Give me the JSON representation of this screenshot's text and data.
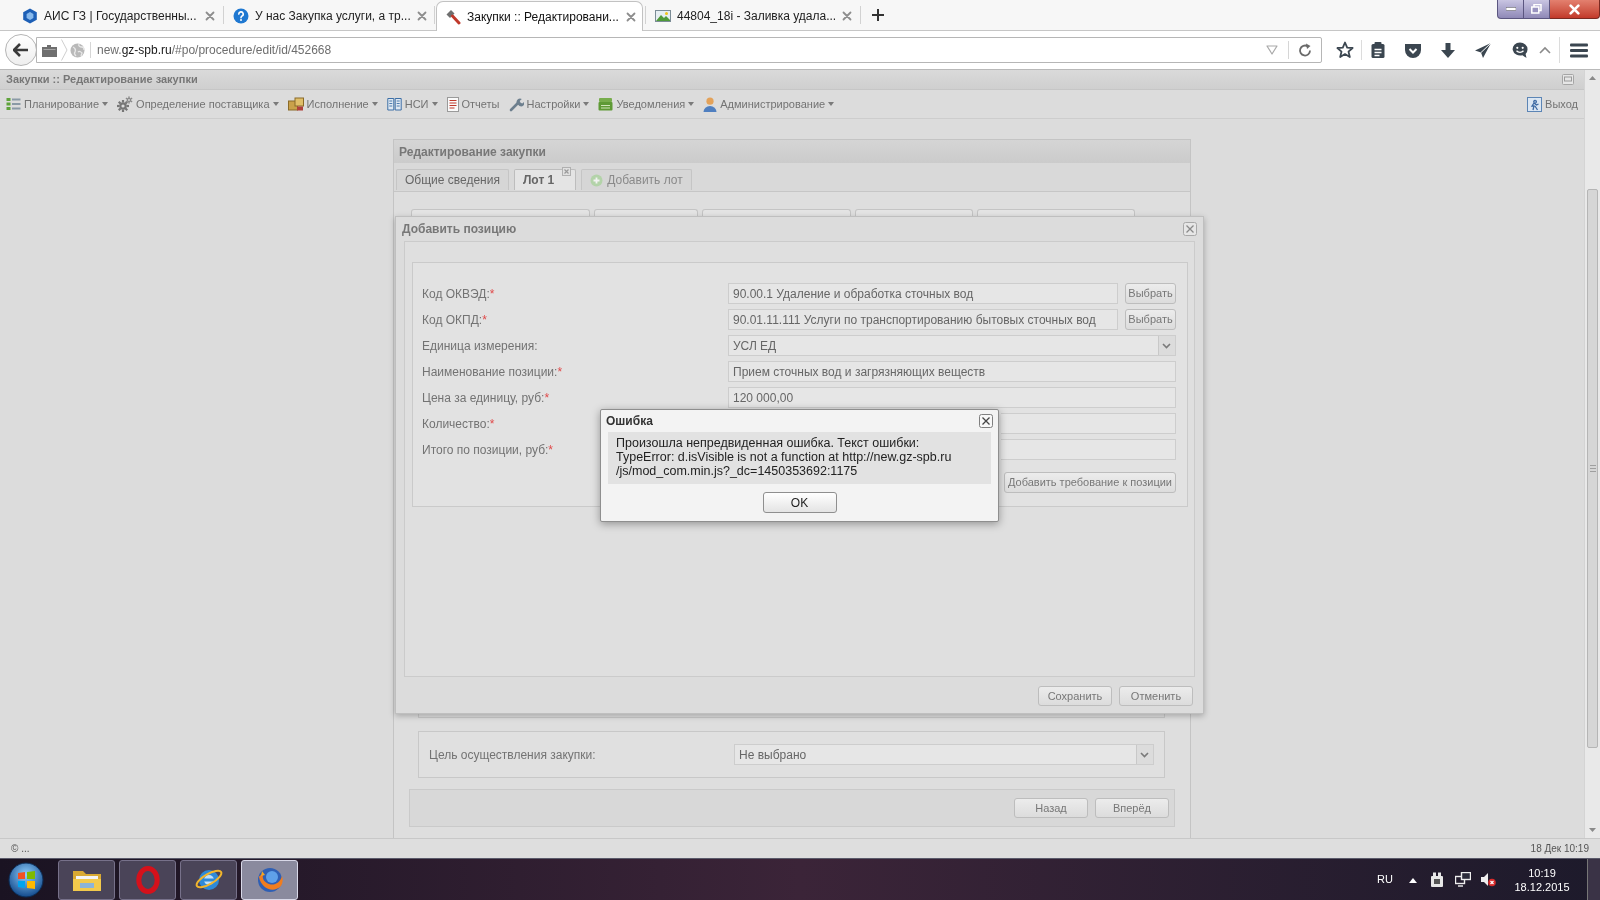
{
  "browser": {
    "tabs": [
      {
        "title": "АИС ГЗ | Государственны...",
        "selected": false
      },
      {
        "title": "У нас Закупка услуги, а тр...",
        "selected": false
      },
      {
        "title": "Закупки :: Редактировани...",
        "selected": true
      },
      {
        "title": "44804_18i - Заливка удала...",
        "selected": false
      }
    ],
    "url": {
      "prefix": "new.",
      "domain": "gz-spb.ru",
      "path": "/#po/procedure/edit/id/452668"
    }
  },
  "app": {
    "title": "Закупки :: Редактирование закупки",
    "menu": [
      {
        "label": "Планирование",
        "has_menu": true
      },
      {
        "label": "Определение поставщика",
        "has_menu": true
      },
      {
        "label": "Исполнение",
        "has_menu": true
      },
      {
        "label": "НСИ",
        "has_menu": true
      },
      {
        "label": "Отчеты",
        "has_menu": false
      },
      {
        "label": "Настройки",
        "has_menu": true
      },
      {
        "label": "Уведомления",
        "has_menu": true
      },
      {
        "label": "Администрирование",
        "has_menu": true
      }
    ],
    "logout": "Выход"
  },
  "panel": {
    "title": "Редактирование закупки",
    "tabs": [
      {
        "label": "Общие сведения",
        "selected": false,
        "closable": false,
        "disabled": false
      },
      {
        "label": "Лот 1",
        "selected": true,
        "closable": true,
        "disabled": false
      },
      {
        "label": "Добавить лот",
        "selected": false,
        "closable": false,
        "disabled": true
      }
    ],
    "purpose": {
      "label": "Цель осуществления закупки:",
      "value": "Не выбрано"
    },
    "buttons": [
      "Назад",
      "Вперёд"
    ]
  },
  "add_position": {
    "title": "Добавить позицию",
    "fields": [
      {
        "kind": "picker",
        "label": "Код ОКВЭД:",
        "required_mark": "*",
        "value": "90.00.1 Удаление и обработка сточных вод",
        "button": "Выбрать"
      },
      {
        "kind": "picker",
        "label": "Код ОКПД:",
        "required_mark": "*",
        "value": "90.01.11.111 Услуги по транспортированию бытовых сточных вод",
        "button": "Выбрать"
      },
      {
        "kind": "select",
        "label": "Единица измерения:",
        "value": "УСЛ ЕД"
      },
      {
        "kind": "text",
        "label": "Наименование позиции:",
        "required_mark": "*",
        "value": "Прием сточных вод и загрязняющих веществ"
      },
      {
        "kind": "text",
        "label": "Цена за единицу, руб:",
        "required_mark": "*",
        "value": "120 000,00"
      },
      {
        "kind": "text",
        "label": "Количество:",
        "required_mark": "*"
      },
      {
        "kind": "text",
        "label": "Итого по позиции, руб:",
        "required_mark": "*"
      }
    ],
    "add_requirement": "Добавить требование к позиции",
    "buttons": [
      "Сохранить",
      "Отменить"
    ]
  },
  "error_dialog": {
    "title": "Ошибка",
    "message_lines": [
      "Произошла непредвиденная ошибка. Текст ошибки:",
      "TypeError: d.isVisible is not a function at http://new.gz-spb.ru",
      "/js/mod_com.min.js?_dc=1450353692:1175"
    ],
    "button": "OK"
  },
  "status_bar": {
    "left": "© ...",
    "right": "18 Дек 10:19"
  },
  "taskbar": {
    "apps": [
      {
        "selected": false
      },
      {
        "selected": false
      },
      {
        "selected": false
      },
      {
        "selected": true
      }
    ],
    "language": "RU",
    "time": "10:19",
    "date": "18.12.2015"
  }
}
